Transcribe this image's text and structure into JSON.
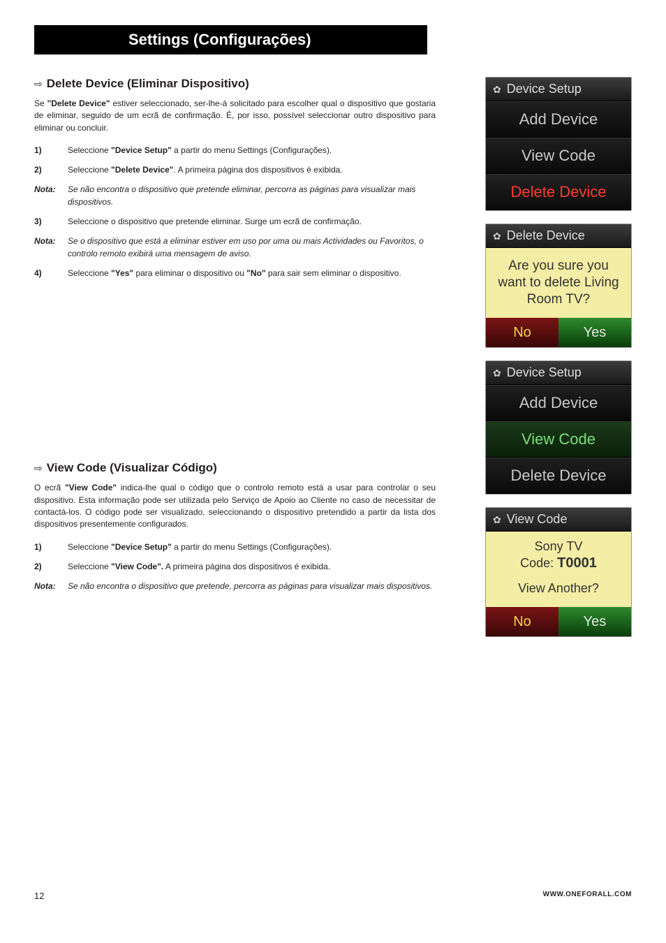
{
  "header": {
    "title": "Settings (Configurações)"
  },
  "s1": {
    "title": "Delete Device (Eliminar Dispositivo)",
    "intro_pre": "Se ",
    "intro_bold": "\"Delete Device\"",
    "intro_post": " estiver seleccionado, ser-lhe-á solicitado para escolher qual o dispositivo que gostaria de eliminar, seguido de um ecrã de confirmação. É, por isso, possível seleccionar outro dispositivo para eliminar ou concluir.",
    "steps": [
      {
        "n": "1)",
        "pre": "Seleccione ",
        "bold": "\"Device Setup\"",
        "post": " a partir do menu Settings (Configurações)."
      },
      {
        "n": "2)",
        "pre": "Seleccione ",
        "bold": "\"Delete Device\"",
        "post": ". A primeira página dos dispositivos é exibida."
      },
      {
        "n": "Nota:",
        "italic": true,
        "pre": "",
        "bold": "",
        "post": "Se não encontra o dispositivo que pretende eliminar, percorra as páginas para visualizar mais dispositivos."
      },
      {
        "n": "3)",
        "pre": "Seleccione o dispositivo que pretende eliminar. Surge um ecrã de confirmação.",
        "bold": "",
        "post": ""
      },
      {
        "n": "Nota:",
        "italic": true,
        "pre": "",
        "bold": "",
        "post": "Se o dispositivo que está a eliminar estiver em uso por uma ou mais Actividades ou Favoritos, o controlo remoto exibirá uma mensagem de aviso."
      },
      {
        "n": "4)",
        "pre": "Seleccione ",
        "bold": "\"Yes\"",
        "mid": " para eliminar o dispositivo ou ",
        "bold2": "\"No\"",
        "post": " para sair sem eliminar o dispositivo."
      }
    ]
  },
  "s2": {
    "title": "View Code (Visualizar Código)",
    "intro_pre": "O ecrã ",
    "intro_bold": "\"View Code\"",
    "intro_post": " indica-lhe qual o código que o controlo remoto está a usar para controlar o seu dispositivo. Esta informação pode ser utilizada pelo Serviço de Apoio ao Cliente no caso de necessitar de contactá-los. O código pode ser visualizado, seleccionando o dispositivo pretendido a partir da lista dos dispositivos presentemente configurados.",
    "steps": [
      {
        "n": "1)",
        "pre": "Seleccione ",
        "bold": "\"Device Setup\"",
        "post": " a partir do menu Settings (Configurações)."
      },
      {
        "n": "2)",
        "pre": "Seleccione ",
        "bold": "\"View Code\".",
        "post": " A primeira página dos dispositivos é exibida."
      },
      {
        "n": "Nota:",
        "italic": true,
        "pre": "",
        "bold": "",
        "post": "Se não encontra o dispositivo que pretende, percorra as páginas para visualizar mais dispositivos."
      }
    ]
  },
  "panelA": {
    "header": "Device Setup",
    "b1": "Add Device",
    "b2": "View Code",
    "b3": "Delete Device"
  },
  "panelB": {
    "header": "Delete Device",
    "msg1": "Are you sure you want to delete Living Room TV?",
    "no": "No",
    "yes": "Yes"
  },
  "panelC": {
    "header": "Device Setup",
    "b1": "Add Device",
    "b2": "View Code",
    "b3": "Delete Device"
  },
  "panelD": {
    "header": "View Code",
    "dev": "Sony TV",
    "code_label": "Code: ",
    "code": "T0001",
    "another": "View Another?",
    "no": "No",
    "yes": "Yes"
  },
  "footer": {
    "page": "12",
    "url": "WWW.ONEFORALL.COM"
  }
}
